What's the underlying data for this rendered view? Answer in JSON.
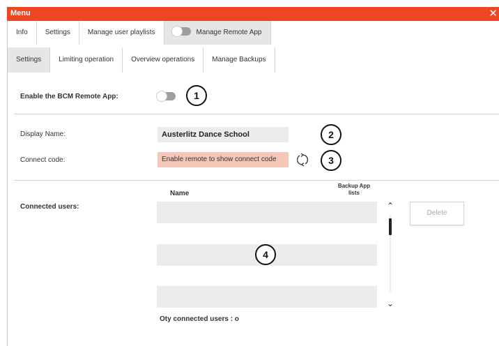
{
  "window": {
    "title": "Menu",
    "close_icon": "close-icon"
  },
  "top_tabs": [
    {
      "label": "Info"
    },
    {
      "label": "Settings"
    },
    {
      "label": "Manage user playlists"
    },
    {
      "label": "Manage Remote App",
      "toggle_on": false
    }
  ],
  "sub_tabs": [
    {
      "label": "Settings"
    },
    {
      "label": "Limiting operation"
    },
    {
      "label": "Overview operations"
    },
    {
      "label": "Manage Backups"
    }
  ],
  "remote": {
    "enable_label": "Enable the BCM Remote App:",
    "enabled": false,
    "display_name_label": "Display Name:",
    "display_name_value": "Austerlitz Dance School",
    "connect_code_label": "Connect code:",
    "connect_code_value": "Enable remote to show connect code"
  },
  "users": {
    "label": "Connected users:",
    "col_name": "Name",
    "col_backup": "Backup App lists",
    "qty_text": "Oty connected users : o",
    "delete_label": "Delete"
  },
  "callouts": [
    "1",
    "2",
    "3",
    "4"
  ],
  "colors": {
    "accent": "#ee4523",
    "connect_code_bg": "#f6c6b8",
    "field_bg": "#ececec"
  }
}
